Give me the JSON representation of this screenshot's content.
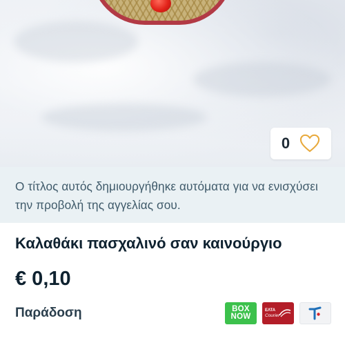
{
  "listing": {
    "likes": "0",
    "notice": "Ο τίτλος αυτός δημιουργήθηκε αυτόματα για να ενισχύσει την προβολή της αγγελίας σου.",
    "title": "Καλαθάκι πασχαλινό σαν καινούργιο",
    "price": "€ 0,10",
    "delivery_label": "Παράδοση"
  },
  "couriers": {
    "boxnow_line1": "BOX",
    "boxnow_line2": "NOW",
    "elta_line1": "ΕΛΤΑ",
    "elta_line2": "Courier"
  },
  "icons": {
    "like": "heart-outline-icon",
    "courier3": "t-logo-icon"
  },
  "colors": {
    "accent_heart": "#e8a93b",
    "boxnow_green": "#3cc14c",
    "elta_red": "#b31d28",
    "notice_bg": "#eaf1f4"
  }
}
